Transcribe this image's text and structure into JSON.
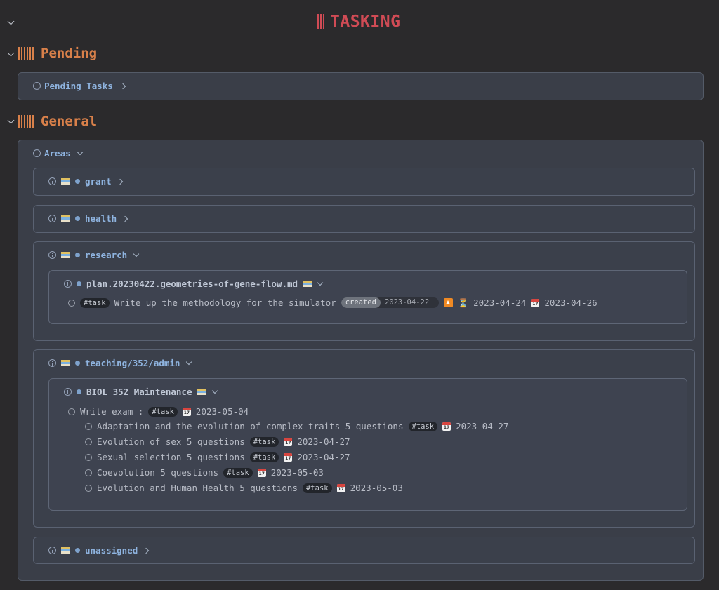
{
  "title": "TASKING",
  "sections": {
    "pending": {
      "heading": "Pending",
      "query_label": "Pending Tasks"
    },
    "general": {
      "heading": "General",
      "areas_label": "Areas",
      "groups": {
        "grant": "grant",
        "health": "health",
        "research": "research",
        "teaching": "teaching/352/admin",
        "unassigned": "unassigned"
      },
      "research_file": {
        "name": "plan.20230422.geometries-of-gene-flow.md",
        "task": {
          "tag": "#task",
          "text": "Write up the methodology for the simulator",
          "created_label": "created",
          "created_date": "2023-04-22",
          "scheduled": "2023-04-24",
          "due": "2023-04-26"
        }
      },
      "teaching_file": {
        "name": "BIOL 352 Maintenance",
        "parent": {
          "text": "Write exam :",
          "tag": "#task",
          "due": "2023-05-04"
        },
        "subtasks": [
          {
            "text": "Adaptation and the evolution of complex traits 5 questions",
            "tag": "#task",
            "due": "2023-04-27"
          },
          {
            "text": "Evolution of sex 5 questions",
            "tag": "#task",
            "due": "2023-04-27"
          },
          {
            "text": "Sexual selection 5 questions",
            "tag": "#task",
            "due": "2023-04-27"
          },
          {
            "text": "Coevolution 5 questions",
            "tag": "#task",
            "due": "2023-05-03"
          },
          {
            "text": "Evolution and Human Health 5 questions",
            "tag": "#task",
            "due": "2023-05-03"
          }
        ]
      }
    }
  },
  "icons": {
    "collapse": "chevron-down-icon",
    "expand": "chevron-right-icon",
    "info": "info-icon",
    "folder": "card-index-dividers-icon",
    "calendar": "calendar-icon",
    "priority": "priority-up-icon",
    "scheduled": "hourglass-icon"
  },
  "colors": {
    "background": "#2b2a2c",
    "title": "#d04b55",
    "heading": "#d8804a",
    "link": "#8fb4e0"
  }
}
